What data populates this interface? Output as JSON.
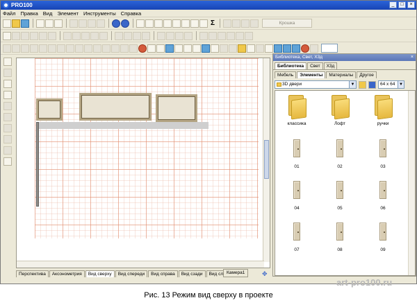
{
  "window": {
    "title": "PRO100",
    "controls": [
      "minimize",
      "maximize",
      "close"
    ]
  },
  "menu": [
    "Файл",
    "Правка",
    "Вид",
    "Элемент",
    "Инструменты",
    "Справка"
  ],
  "toolbar": {
    "kroshka_label": "Крошка"
  },
  "view_tabs": [
    "Перспектива",
    "Аксонометрия",
    "Вид сверху",
    "Вид спереди",
    "Вид справа",
    "Вид сзади",
    "Вид слева"
  ],
  "active_view_tab": "Вид сверху",
  "camera_tab": "Камера1",
  "library": {
    "panel_title": "Библиотека, Свет, Х3д",
    "tabs_top": [
      "Библиотека",
      "Свет",
      "Х3д"
    ],
    "tabs_sub": [
      "Мебель",
      "Элементы",
      "Материалы",
      "Другое"
    ],
    "folder": "3D двери",
    "thumb_size": "64 x 64",
    "items": [
      "классика",
      "Лофт",
      "ручки",
      "01",
      "02",
      "03",
      "04",
      "05",
      "06",
      "07",
      "08",
      "09"
    ]
  },
  "caption": "Рис. 13 Режим вид сверху в проекте",
  "watermark": "art-pro100.ru",
  "colors": {
    "titlebar": "#1f50c5",
    "grid_line": "#e88c6e",
    "window_bg": "#ece9d8"
  }
}
